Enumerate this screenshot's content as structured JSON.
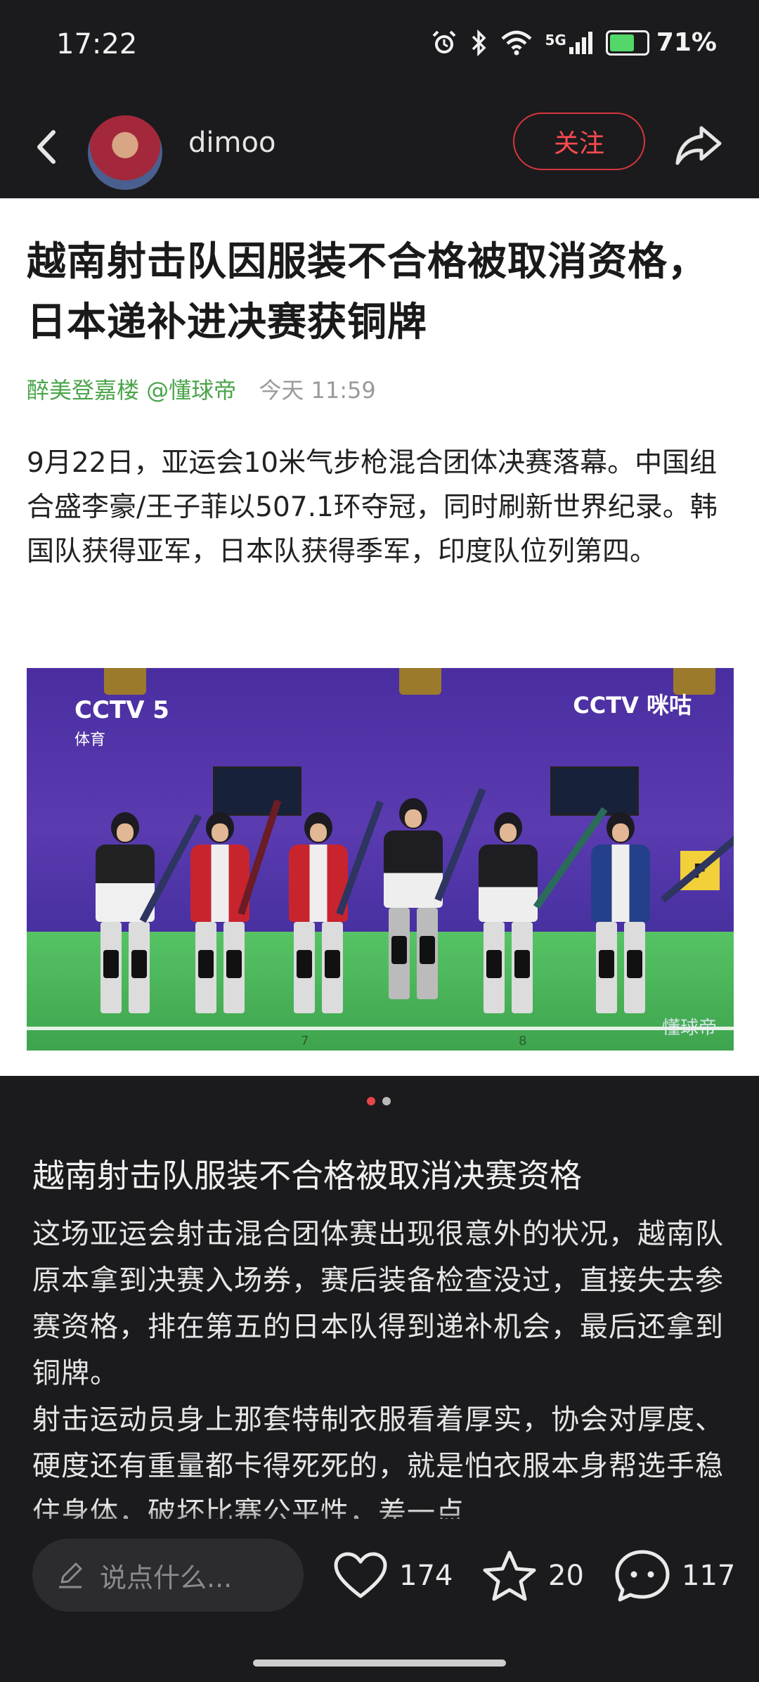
{
  "status_bar": {
    "time": "17:22",
    "network": "5G",
    "battery": "71%",
    "battery_level": 0.71,
    "icons": [
      "alarm-icon",
      "bluetooth-icon",
      "wifi-icon",
      "signal-icon",
      "battery-charging-icon"
    ]
  },
  "nav": {
    "username": "dimoo",
    "follow_label": "关注",
    "icons": [
      "back-arrow-icon",
      "share-icon"
    ]
  },
  "article": {
    "title": "越南射击队因服装不合格被取消资格，日本递补进决赛获铜牌",
    "author": "醉美登嘉楼 @懂球帝",
    "date": "今天 11:59",
    "paragraph": "9月22日，亚运会10米气步枪混合团体决赛落幕。中国组合盛李豪/王子菲以507.1环夺冠，同时刷新世界纪录。韩国队获得亚军，日本队获得季军，印度队位列第四。",
    "image": {
      "logo_left": "CCTV 5",
      "logo_left_sub": "体育",
      "logo_right": "CCTV 咪咕",
      "watermark": "懂球帝",
      "lane_labels": [
        "7",
        "8"
      ],
      "target_letter": "F"
    }
  },
  "pager": {
    "total": 2,
    "active": 1
  },
  "section": {
    "title": "越南射击队服装不合格被取消决赛资格",
    "paragraphs": [
      "这场亚运会射击混合团体赛出现很意外的状况，越南队原本拿到决赛入场券，赛后装备检查没过，直接失去参赛资格，排在第五的日本队得到递补机会，最后还拿到铜牌。",
      "射击运动员身上那套特制衣服看着厚实，协会对厚度、硬度还有重量都卡得死死的，就是怕衣服本身帮选手稳住身体，破坏比赛公平性，差一点"
    ]
  },
  "bottom_bar": {
    "comment_placeholder": "说点什么...",
    "likes": "174",
    "favorites": "20",
    "comments": "117"
  },
  "colors": {
    "background": "#1b1b1d",
    "accent_red": "#ff4b4f",
    "author_green": "#4aa44a"
  }
}
